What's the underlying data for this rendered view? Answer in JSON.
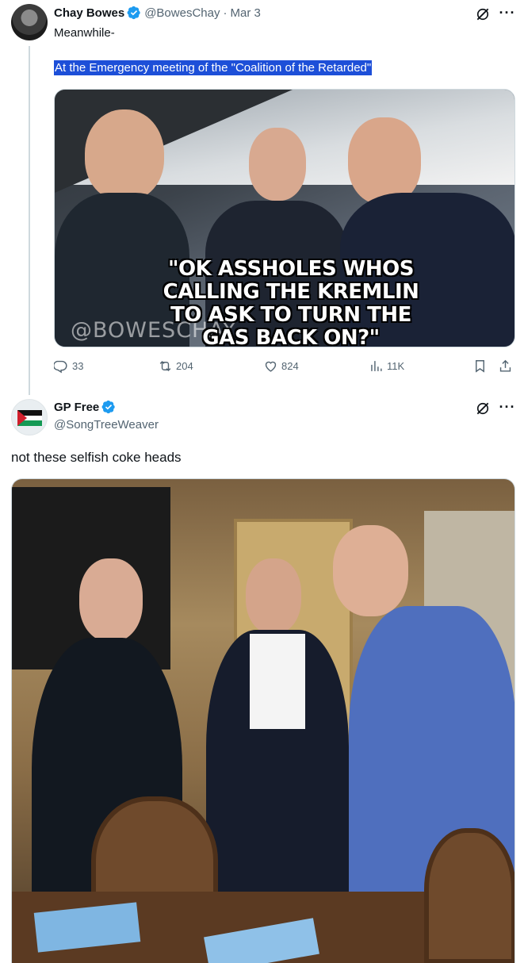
{
  "tweet1": {
    "author_name": "Chay Bowes",
    "handle": "@BowesChay",
    "separator": "·",
    "date": "Mar 3",
    "text": "Meanwhile-",
    "highlighted_text": "At the Emergency meeting of the \"Coalition of the Retarded\"",
    "media": {
      "meme_text": "\"OK ASSHOLES WHOS CALLING THE KREMLIN TO ASK TO TURN THE GAS BACK ON?\"",
      "watermark": "@BOWESCHAY"
    },
    "actions": {
      "replies": "33",
      "reposts": "204",
      "likes": "824",
      "views": "11K"
    }
  },
  "tweet2": {
    "author_name": "GP Free",
    "handle": "@SongTreeWeaver",
    "text": "not these selfish coke heads"
  },
  "icons": {
    "verified": "verified-badge-icon",
    "grok": "grok-icon",
    "more": "more-icon",
    "reply": "reply-icon",
    "repost": "repost-icon",
    "like": "like-icon",
    "views": "views-icon",
    "bookmark": "bookmark-icon",
    "share": "share-icon"
  },
  "colors": {
    "verified": "#1d9bf0",
    "highlight": "#1d4fd8",
    "muted": "#536471"
  }
}
